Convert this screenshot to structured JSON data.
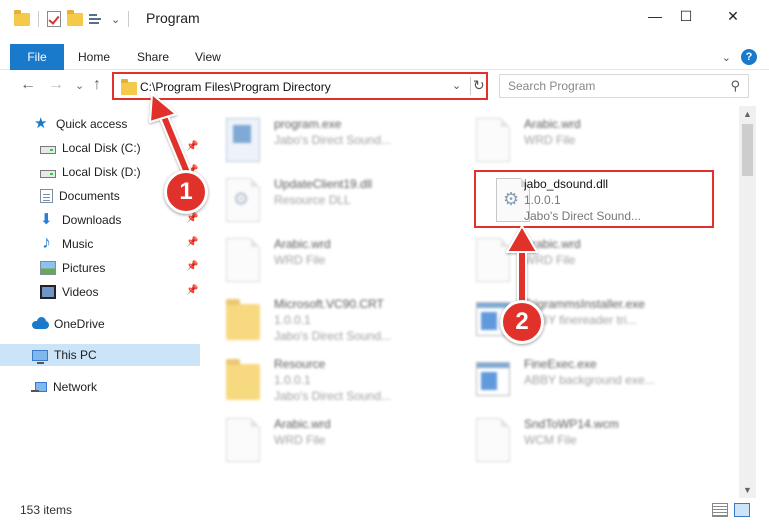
{
  "window": {
    "title": "Program",
    "minimize_glyph": "—",
    "maximize_glyph": "☐",
    "close_glyph": "✕"
  },
  "ribbon": {
    "tabs": [
      "File",
      "Home",
      "Share",
      "View"
    ],
    "expand_glyph": "⌄",
    "help_glyph": "?"
  },
  "nav": {
    "back_glyph": "←",
    "forward_glyph": "→",
    "recent_glyph": "⌄",
    "up_glyph": "↑",
    "address": "C:\\Program Files\\Program Directory",
    "dropdown_glyph": "⌄",
    "refresh_glyph": "↻"
  },
  "search": {
    "placeholder": "Search Program",
    "icon": "search-icon",
    "glyph": "⚲"
  },
  "sidebar": {
    "pin_glyph": "📌",
    "items": [
      {
        "label": "Quick access",
        "icon": "star-icon"
      },
      {
        "label": "Local Disk (C:)",
        "icon": "drive-icon",
        "pinned": true
      },
      {
        "label": "Local Disk (D:)",
        "icon": "drive-icon",
        "pinned": true
      },
      {
        "label": "Documents",
        "icon": "documents-icon",
        "pinned": true
      },
      {
        "label": "Downloads",
        "icon": "downloads-icon",
        "pinned": true
      },
      {
        "label": "Music",
        "icon": "music-icon",
        "pinned": true
      },
      {
        "label": "Pictures",
        "icon": "pictures-icon",
        "pinned": true
      },
      {
        "label": "Videos",
        "icon": "videos-icon",
        "pinned": true
      },
      {
        "label": "OneDrive",
        "icon": "onedrive-icon"
      },
      {
        "label": "This PC",
        "icon": "computer-icon",
        "selected": true
      },
      {
        "label": "Network",
        "icon": "network-icon"
      }
    ]
  },
  "files": [
    {
      "name": "program.exe",
      "line2": "",
      "line3": "Jabo's Direct Sound...",
      "icon": "exe-file-icon"
    },
    {
      "name": "Arabic.wrd",
      "line2": "WRD File",
      "line3": "",
      "icon": "blank-file-icon"
    },
    {
      "name": "UpdateClient19.dll",
      "line2": "Resource DLL",
      "line3": "",
      "icon": "dll-file-icon"
    },
    {
      "name": "jabo_dsound.dll",
      "line2": "1.0.0.1",
      "line3": "Jabo's Direct Sound...",
      "icon": "dll-file-icon",
      "highlighted": true
    },
    {
      "name": "Arabic.wrd",
      "line2": "WRD File",
      "line3": "",
      "icon": "blank-file-icon"
    },
    {
      "name": "Arabic.wrd",
      "line2": "WRD File",
      "line3": "",
      "icon": "blank-file-icon"
    },
    {
      "name": "Microsoft.VC90.CRT",
      "line2": "1.0.0.1",
      "line3": "Jabo's Direct Sound...",
      "icon": "folder-icon"
    },
    {
      "name": "TrigrammsInstaller.exe",
      "line2": "ABBY finereader tri...",
      "line3": "",
      "icon": "app-icon"
    },
    {
      "name": "Resource",
      "line2": "1.0.0.1",
      "line3": "Jabo's Direct Sound...",
      "icon": "folder-icon"
    },
    {
      "name": "FineExec.exe",
      "line2": "ABBY background exe...",
      "line3": "",
      "icon": "app-icon"
    },
    {
      "name": "Arabic.wrd",
      "line2": "WRD File",
      "line3": "",
      "icon": "blank-file-icon"
    },
    {
      "name": "SndToWP14.wcm",
      "line2": "WCM File",
      "line3": "",
      "icon": "blank-file-icon"
    }
  ],
  "status": {
    "item_count": "153 items"
  },
  "annotations": {
    "step1": "1",
    "step2": "2",
    "color": "#e0322a"
  },
  "colors": {
    "accent": "#1979ca",
    "selection": "#cce4f7"
  }
}
